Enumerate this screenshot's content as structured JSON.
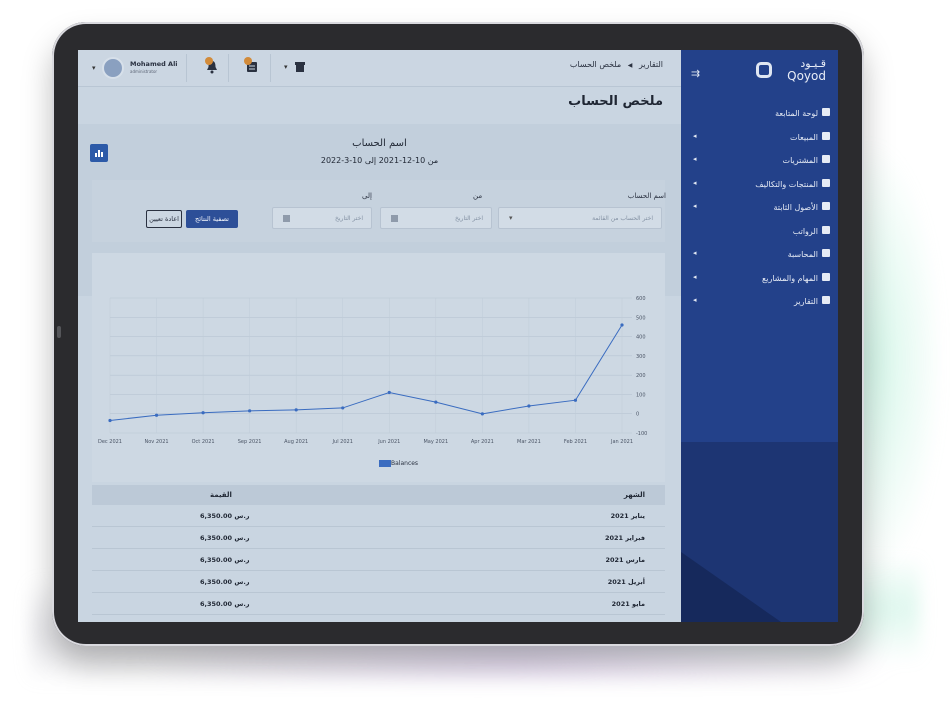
{
  "sidebar": {
    "brand_ar": "قـيـود",
    "brand_en": "Qoyod",
    "items": [
      {
        "label": "لوحة المتابعة",
        "expandable": false
      },
      {
        "label": "المبيعات",
        "expandable": true
      },
      {
        "label": "المشتريات",
        "expandable": true
      },
      {
        "label": "المنتجات والتكاليف",
        "expandable": true
      },
      {
        "label": "الأصول الثابتة",
        "expandable": true
      },
      {
        "label": "الرواتب",
        "expandable": false
      },
      {
        "label": "المحاسبة",
        "expandable": true
      },
      {
        "label": "المهام والمشاريع",
        "expandable": true
      },
      {
        "label": "التقارير",
        "expandable": true
      }
    ]
  },
  "topbar": {
    "user_name": "Mohamed Ali",
    "user_role": "administrator",
    "notifications_badge": "",
    "messages_badge": ""
  },
  "breadcrumb": {
    "parent": "التقارير",
    "separator": "◀",
    "current": "ملخص الحساب"
  },
  "page_title": "ملخص الحساب",
  "summary": {
    "title": "اسم الحساب",
    "range": "من 10-12-2021 إلى 10-3-2022"
  },
  "filters": {
    "account_label": "اسم الحساب",
    "account_placeholder": "اختر الحساب من القائمة",
    "from_label": "من",
    "from_placeholder": "اختر التاريخ",
    "to_label": "إلى",
    "to_placeholder": "اختر التاريخ",
    "apply_label": "تصفية النتائج",
    "reset_label": "اعادة تعيين"
  },
  "chart_data": {
    "type": "line",
    "categories": [
      "Jan 2021",
      "Feb 2021",
      "Mar 2021",
      "Apr 2021",
      "May 2021",
      "Jun 2021",
      "Jul 2021",
      "Aug 2021",
      "Sep 2021",
      "Oct 2021",
      "Nov 2021",
      "Dec 2021"
    ],
    "series": [
      {
        "name": "Balances",
        "values": [
          460,
          70,
          40,
          -1,
          60,
          110,
          30,
          20,
          15,
          5,
          -8,
          -35
        ]
      }
    ],
    "y_ticks": [
      "-100",
      "0",
      "100",
      "200",
      "300",
      "400",
      "500",
      "600"
    ],
    "ylim": [
      -100,
      600
    ],
    "grid": true,
    "legend": "bottom",
    "color": "#3a6cc0"
  },
  "table": {
    "headers": {
      "month": "الشهر",
      "value": "القيمة"
    },
    "rows": [
      {
        "month": "يناير 2021",
        "value": "6,350.00 ر.س"
      },
      {
        "month": "فبراير 2021",
        "value": "6,350.00 ر.س"
      },
      {
        "month": "مارس 2021",
        "value": "6,350.00 ر.س"
      },
      {
        "month": "أبريل 2021",
        "value": "6,350.00 ر.س"
      },
      {
        "month": "مايو 2021",
        "value": "6,350.00 ر.س"
      }
    ]
  }
}
